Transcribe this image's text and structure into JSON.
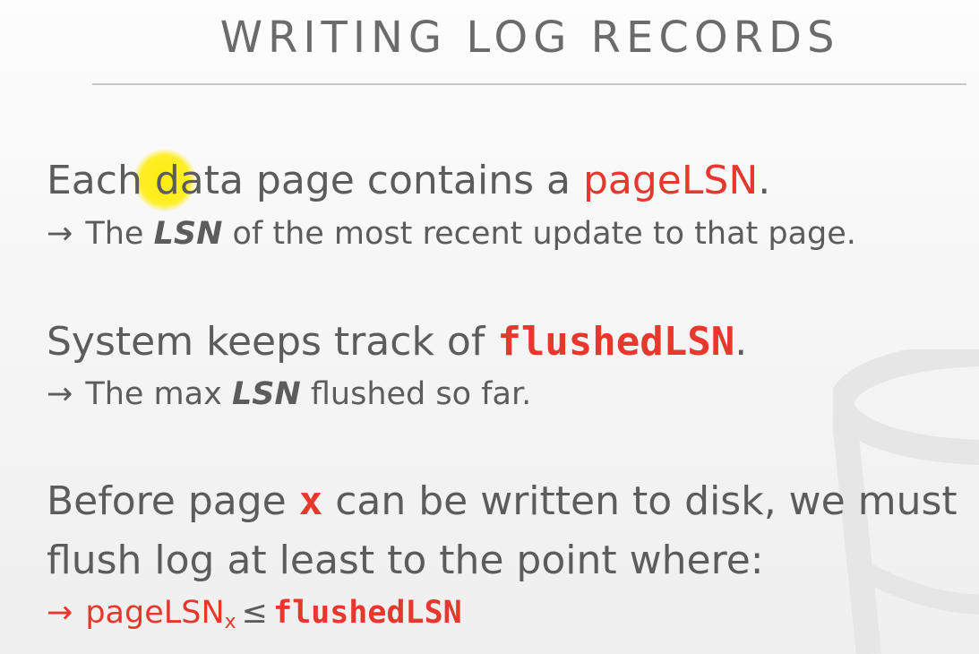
{
  "slide": {
    "title": "WRITING LOG RECORDS",
    "accent_color": "#e8372c",
    "text_color": "#5c5c5c"
  },
  "bullets": [
    {
      "prefix": "Each data page contains a ",
      "term": "pageLSN",
      "suffix": ".",
      "sub": {
        "arrow": "→",
        "before": "The ",
        "emph": "LSN",
        "after": " of the most recent update to that page."
      }
    },
    {
      "prefix": "System keeps track of ",
      "term": "flushedLSN",
      "suffix": ".",
      "sub": {
        "arrow": "→",
        "before": "The max ",
        "emph": "LSN",
        "after": " flushed so far."
      }
    },
    {
      "line1_prefix": "Before page ",
      "line1_term": "x",
      "line1_suffix": " can be written to disk, we must",
      "line2": "flush log at least to the point where:",
      "formula": {
        "arrow": "→",
        "left": "pageLSN",
        "left_subscript": "x",
        "operator": "≤",
        "right": "flushedLSN"
      }
    }
  ],
  "watermark_icon": "database-cylinder-icon",
  "cursor_highlight_icon": "cursor-highlight-icon"
}
